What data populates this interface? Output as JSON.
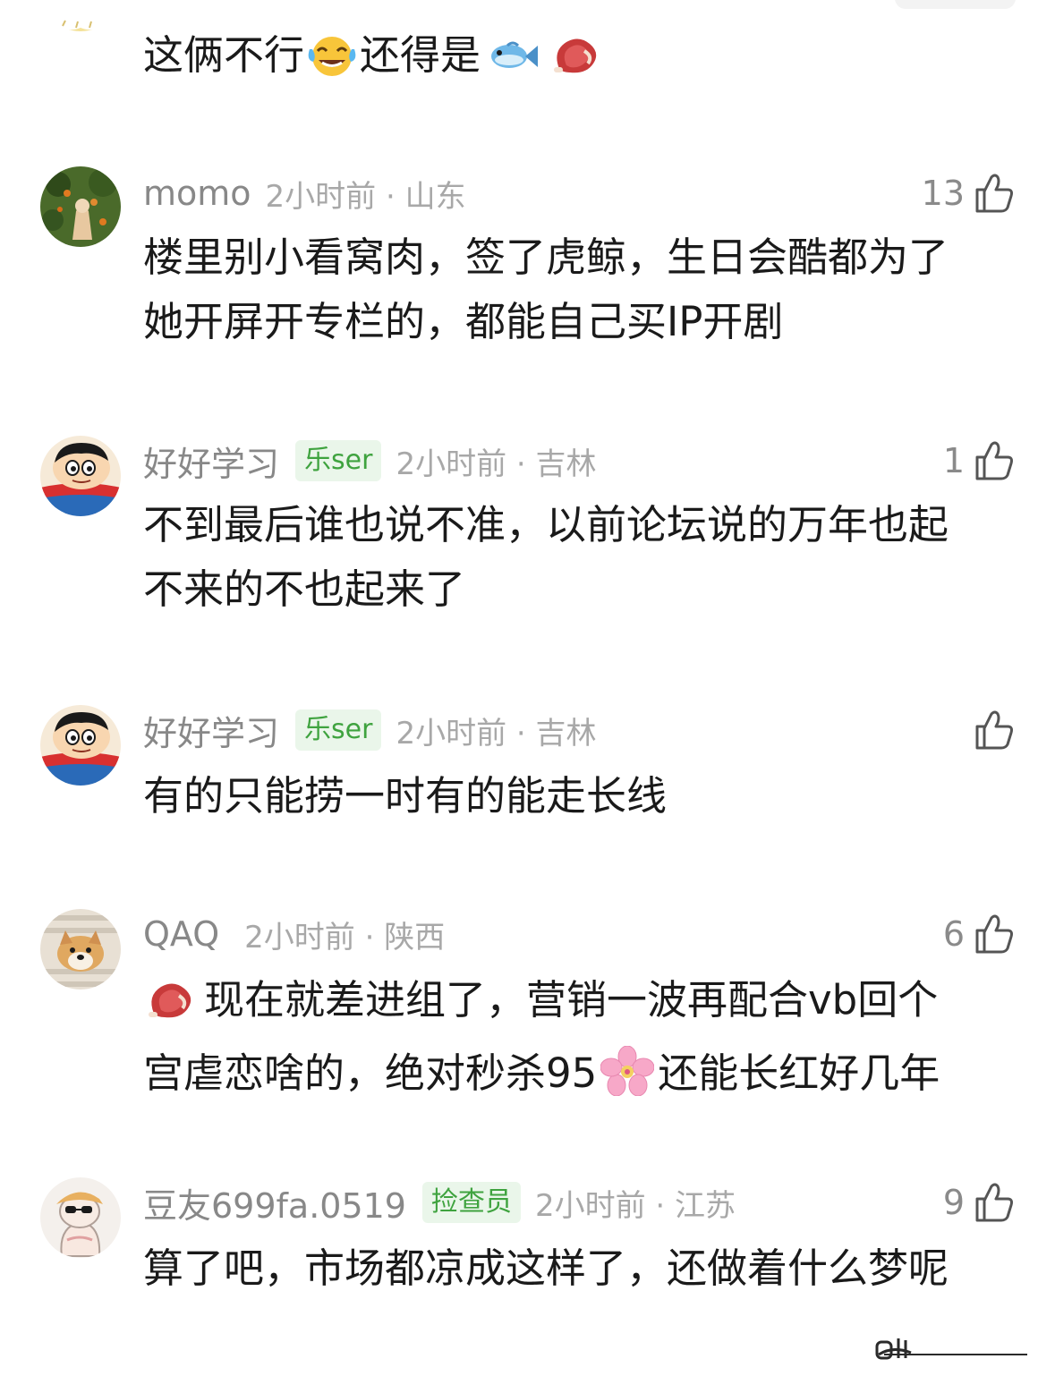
{
  "comments": [
    {
      "username": "",
      "badge": "",
      "time_location": "",
      "likes": "",
      "lines": [
        "这俩不行",
        "还得是"
      ]
    },
    {
      "username": "momo",
      "badge": "",
      "time_location": "2小时前 · 山东",
      "likes": "13",
      "lines": [
        "楼里别小看窝肉，签了虎鲸，生日会酷都为了",
        "她开屏开专栏的，都能自己买IP开剧"
      ]
    },
    {
      "username": "好好学习",
      "badge": "乐ser",
      "time_location": "2小时前 · 吉林",
      "likes": "1",
      "lines": [
        "不到最后谁也说不准，以前论坛说的万年也起",
        "不来的不也起来了"
      ]
    },
    {
      "username": "好好学习",
      "badge": "乐ser",
      "time_location": "2小时前 · 吉林",
      "likes": "",
      "lines": [
        "有的只能捞一时有的能走长线"
      ]
    },
    {
      "username": "QAQ",
      "badge": "",
      "time_location": "2小时前 · 陕西",
      "likes": "6",
      "lines": [
        "现在就差进组了，营销一波再配合vb回个",
        "宫虐恋啥的，绝对秒杀95",
        "还能长红好几年"
      ]
    },
    {
      "username": "豆友699fa.0519",
      "badge": "捡查员",
      "time_location": "2小时前 · 江苏",
      "likes": "9",
      "lines": [
        "算了吧，市场都凉成这样了，还做着什么梦呢"
      ]
    }
  ],
  "icons": {
    "like": "thumbs-up-icon",
    "emoji_laugh": "tears-of-joy-emoji",
    "emoji_fish": "fish-emoji",
    "emoji_meat": "steak-emoji",
    "emoji_flower": "cherry-blossom-emoji"
  },
  "colors": {
    "username": "#888888",
    "meta": "#a8a8a8",
    "body": "#1a1a1a",
    "badge_bg": "#eaf6ea",
    "badge_text": "#3fa33f"
  }
}
